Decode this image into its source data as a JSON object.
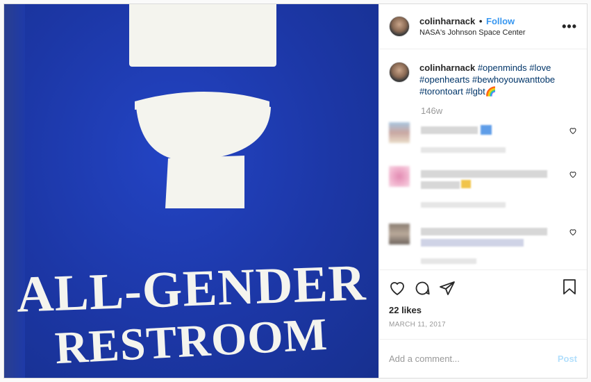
{
  "photo": {
    "sign_line1": "ALL-GENDER",
    "sign_line2": "RESTROOM",
    "bg_color": "#1e3aa8"
  },
  "header": {
    "username": "colinharnack",
    "separator": "•",
    "follow_label": "Follow",
    "location": "NASA's Johnson Space Center",
    "more_label": "•••"
  },
  "caption": {
    "username": "colinharnack",
    "hashtags": [
      "#openminds",
      "#love",
      "#openhearts",
      "#bewhoyouwanttobe",
      "#torontoart",
      "#lgbt"
    ],
    "emoji": "🌈",
    "time_ago": "146w"
  },
  "actions": {
    "likes": "22 likes",
    "date": "MARCH 11, 2017"
  },
  "add_comment": {
    "placeholder": "Add a comment...",
    "post_label": "Post"
  },
  "colors": {
    "accent": "#3897f0",
    "hashtag": "#003569",
    "muted": "#999999",
    "post_disabled": "#b2dffc"
  }
}
